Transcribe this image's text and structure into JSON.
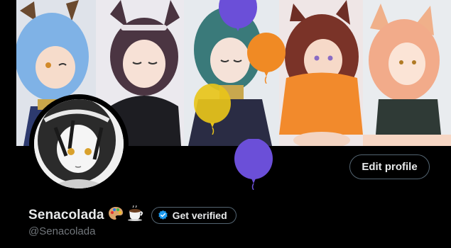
{
  "profile": {
    "display_name": "Senacolada",
    "handle": "@Senacolada",
    "name_emojis": [
      "palette-emoji",
      "coffee-emoji"
    ],
    "edit_profile_label": "Edit profile",
    "get_verified_label": "Get verified"
  },
  "colors": {
    "background": "#000000",
    "text_primary": "#e7e9ea",
    "text_secondary": "#71767b",
    "border": "#536471",
    "verified_blue": "#1d9bf0",
    "balloon_purple": "#6b4fd8",
    "balloon_orange": "#f08a24",
    "balloon_yellow": "#e8c41a"
  },
  "banner": {
    "panels": [
      "blue-hair-character",
      "cat-ear-character-black-top",
      "green-hair-character",
      "red-hair-character-orange-hoodie",
      "fox-ear-character-sports-top"
    ],
    "balloons": [
      "purple-balloon-top",
      "orange-balloon",
      "yellow-balloon",
      "purple-balloon-bottom"
    ]
  }
}
